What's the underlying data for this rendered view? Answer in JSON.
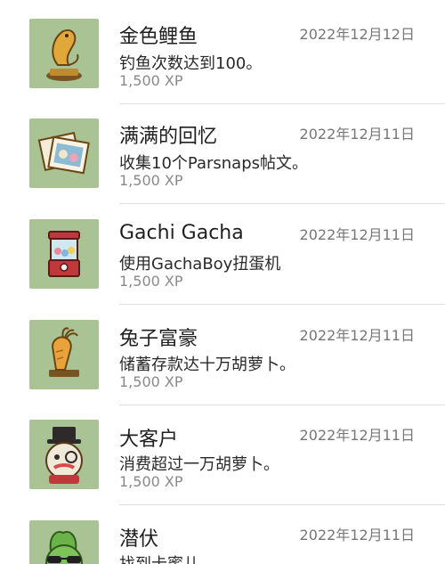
{
  "achievements": [
    {
      "title": "金色鲤鱼",
      "desc": "钓鱼次数达到100。",
      "xp": "1,500 XP",
      "date": "2022年12月12日",
      "icon": "golden-carp-trophy-icon"
    },
    {
      "title": "满满的回忆",
      "desc": "收集10个Parsnaps帖文。",
      "xp": "1,500 XP",
      "date": "2022年12月11日",
      "icon": "photo-album-icon"
    },
    {
      "title": "Gachi Gacha",
      "desc": "使用GachaBoy扭蛋机",
      "xp": "1,500 XP",
      "date": "2022年12月11日",
      "icon": "gacha-machine-icon"
    },
    {
      "title": "兔子富豪",
      "desc": "储蓄存款达十万胡萝卜。",
      "xp": "1,500 XP",
      "date": "2022年12月11日",
      "icon": "golden-carrot-trophy-icon"
    },
    {
      "title": "大客户",
      "desc": "消费超过一万胡萝卜。",
      "xp": "1,500 XP",
      "date": "2022年12月11日",
      "icon": "top-hat-bunny-icon"
    },
    {
      "title": "潜伏",
      "desc": "找到卡蜜儿。",
      "xp": "",
      "date": "2022年12月11日",
      "icon": "sunglasses-bunny-icon"
    }
  ]
}
